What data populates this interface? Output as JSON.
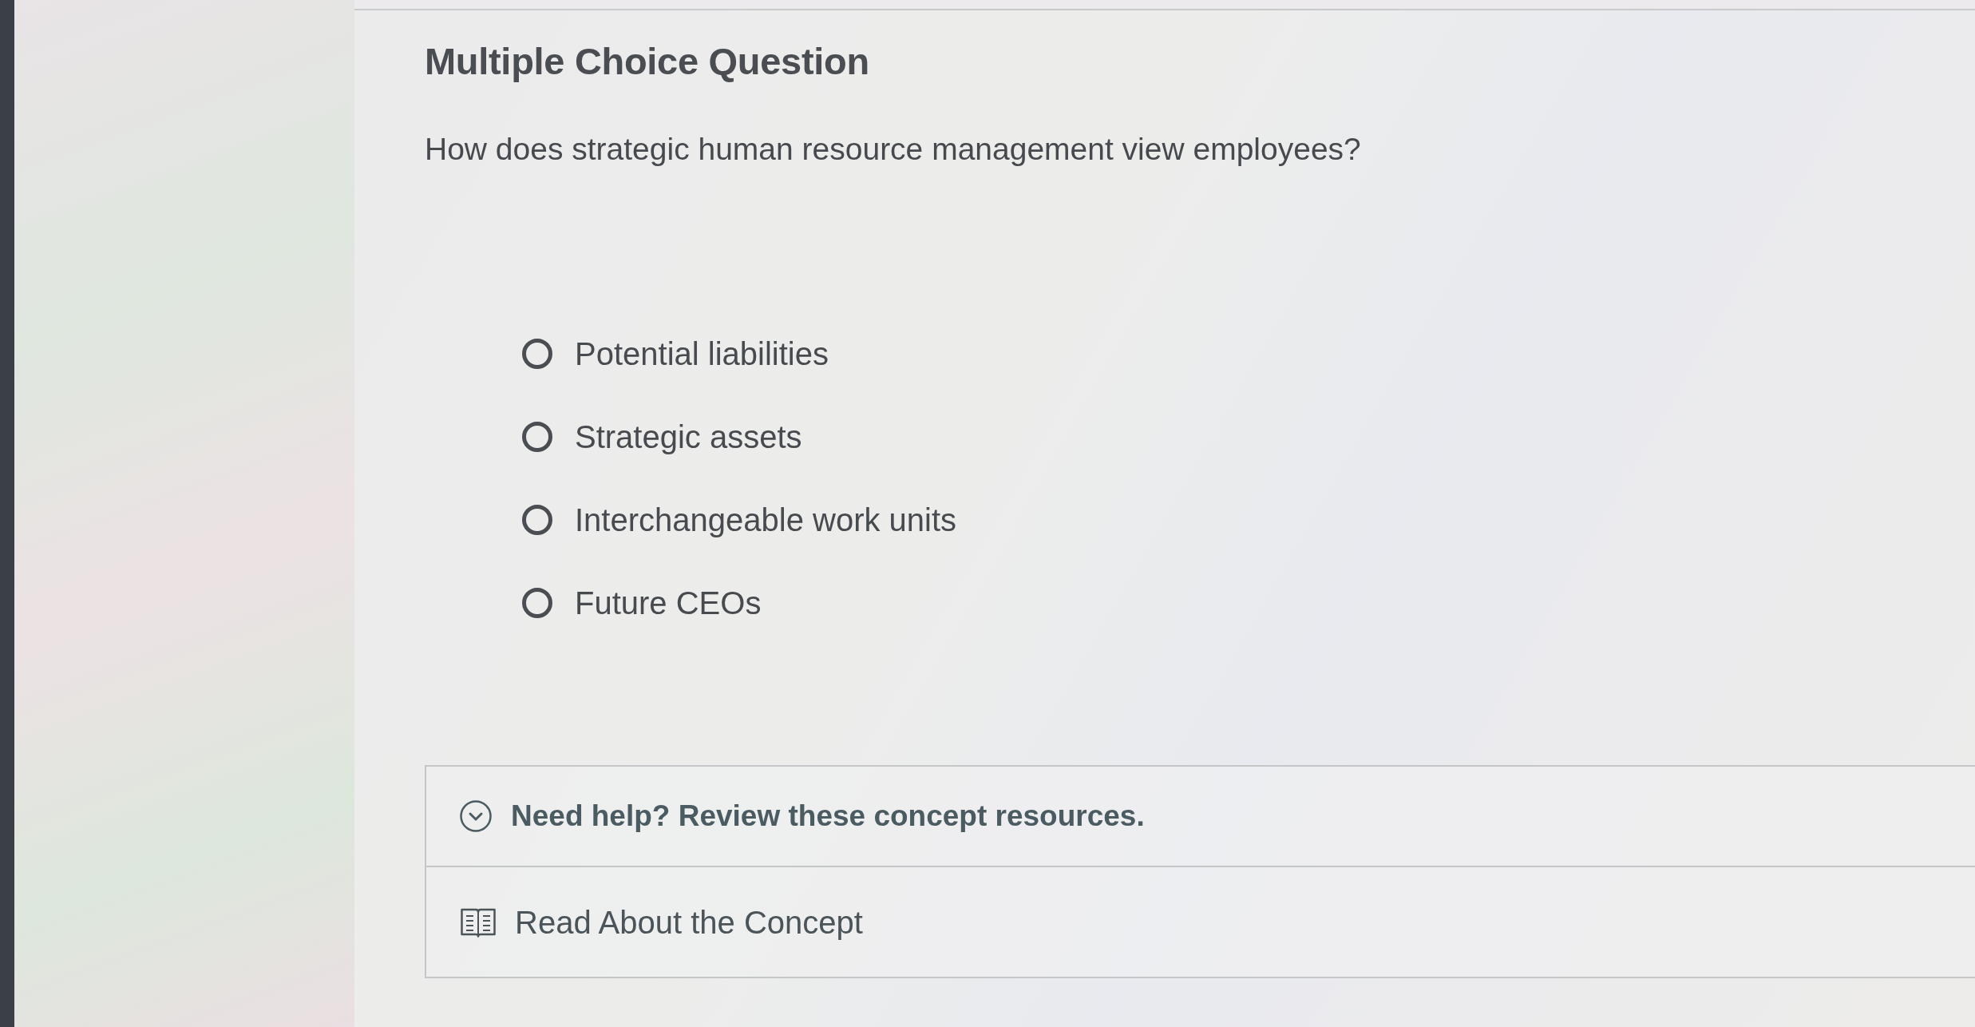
{
  "question": {
    "type_label": "Multiple Choice Question",
    "prompt": "How does strategic human resource management view employees?",
    "options": [
      {
        "label": "Potential liabilities",
        "selected": false
      },
      {
        "label": "Strategic assets",
        "selected": false
      },
      {
        "label": "Interchangeable work units",
        "selected": false
      },
      {
        "label": "Future CEOs",
        "selected": false
      }
    ]
  },
  "help": {
    "title": "Need help? Review these concept resources.",
    "expanded": true,
    "resources": [
      {
        "label": "Read About the Concept"
      }
    ]
  }
}
